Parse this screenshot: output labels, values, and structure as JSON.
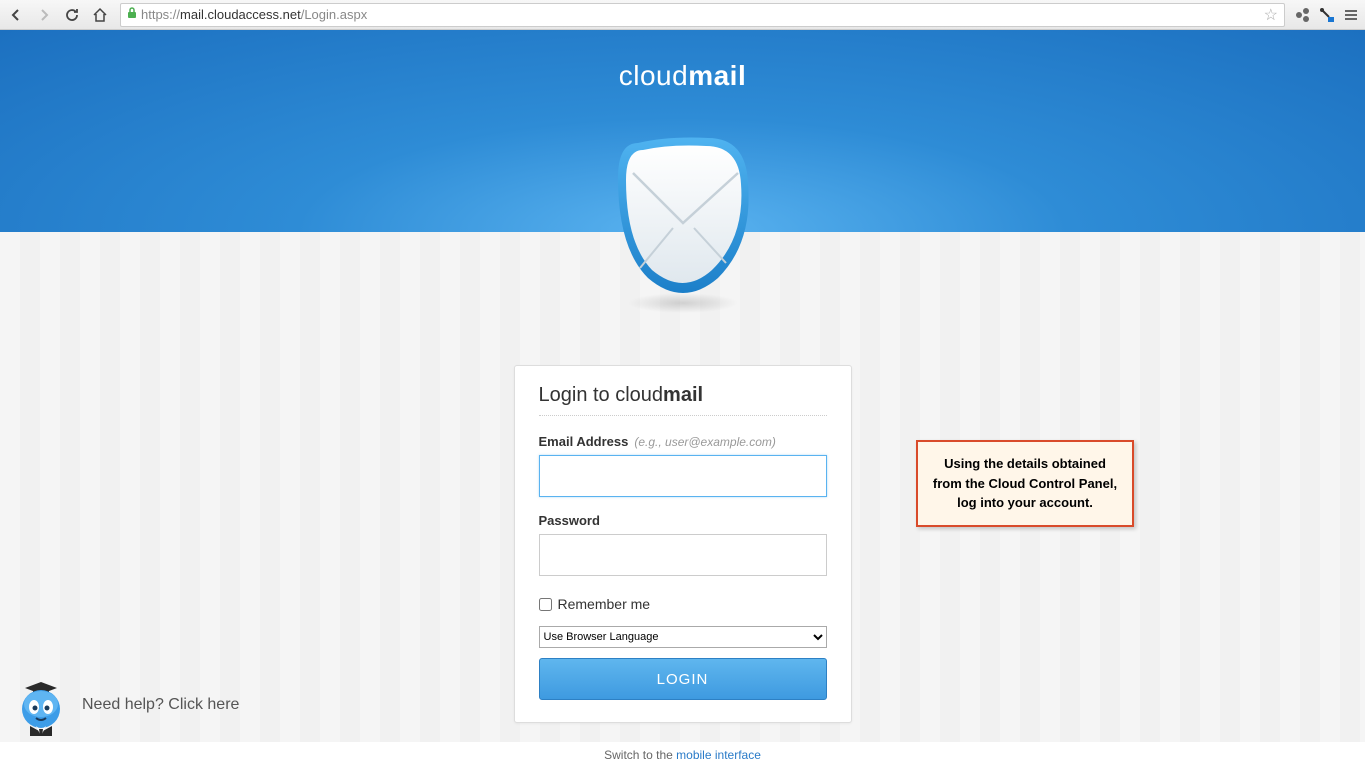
{
  "browser": {
    "url_protocol": "https://",
    "url_domain": "mail.cloudaccess.net",
    "url_path": "/Login.aspx"
  },
  "brand": {
    "prefix": "cloud",
    "bold": "mail"
  },
  "login": {
    "title_prefix": "Login to cloud",
    "title_bold": "mail",
    "email_label": "Email Address",
    "email_hint": "(e.g., user@example.com)",
    "email_value": "",
    "password_label": "Password",
    "password_value": "",
    "remember_label": "Remember me",
    "language_selected": "Use Browser Language",
    "login_button": "LOGIN"
  },
  "switch": {
    "prefix": "Switch to the ",
    "link": "mobile interface"
  },
  "callout": {
    "text": "Using the details obtained from the Cloud Control Panel, log into your account."
  },
  "help": {
    "text": "Need help? Click here"
  }
}
